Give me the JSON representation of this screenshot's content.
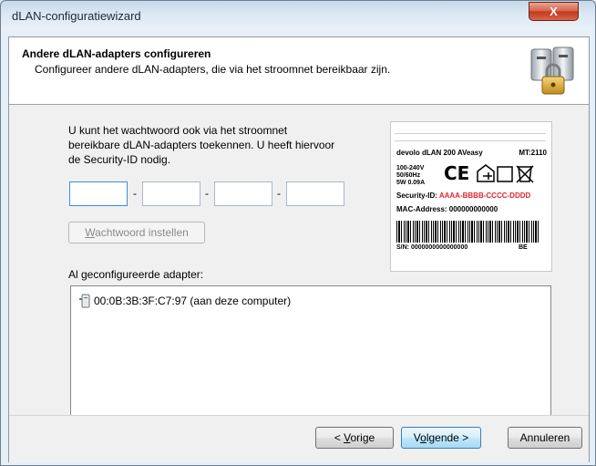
{
  "window": {
    "title": "dLAN-configuratiewizard",
    "close_glyph": "X"
  },
  "header": {
    "title": "Andere dLAN-adapters configureren",
    "subtitle": "Configureer andere dLAN-adapters, die via het stroomnet bereikbaar zijn.",
    "icon": "security-lock-adapters-icon"
  },
  "main": {
    "intro_text": "U kunt het wachtwoord ook via het stroomnet bereikbare dLAN-adapters toekennen. U heeft hiervoor de Security-ID nodig.",
    "security_id_fields": [
      "",
      "",
      "",
      ""
    ],
    "separator": "-",
    "set_password_button": {
      "accel": "W",
      "rest": "achtwoord instellen",
      "enabled": false
    },
    "device_label": {
      "product": "devolo dLAN 200 AVeasy",
      "model": "MT:2110",
      "voltage": [
        "100-240V",
        "50/60Hz",
        "5W 0.09A"
      ],
      "ce_mark": "CE",
      "security_id_label": "Security-ID:",
      "security_id_value": "AAAA-BBBB-CCCC-DDDD",
      "security_id_color": "#e3262f",
      "mac_label": "MAC-Address: 000000000000",
      "serial": "S/N: 0000000000000000",
      "country": "BE"
    },
    "configured_label": "Al geconfigureerde adapter:",
    "configured_adapters": [
      {
        "icon": "adapter-device-icon",
        "text": "00:0B:3B:3F:C7:97  (aan deze computer)"
      }
    ]
  },
  "footer": {
    "prev_button": {
      "prefix": "< ",
      "accel": "V",
      "rest": "orige"
    },
    "next_button": {
      "prefix": "V",
      "accel": "o",
      "rest": "lgende >"
    },
    "cancel_button": "Annuleren"
  }
}
